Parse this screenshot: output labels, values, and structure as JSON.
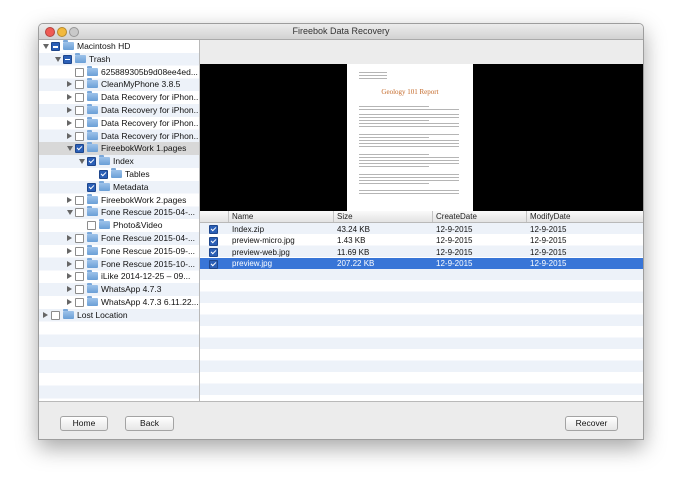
{
  "window": {
    "title": "Fireebok Data Recovery"
  },
  "tree": [
    {
      "label": "Macintosh HD",
      "level": 0,
      "tri": "open",
      "check": "mixed"
    },
    {
      "label": "Trash",
      "level": 1,
      "tri": "open",
      "check": "mixed"
    },
    {
      "label": "625889305b9d08ee4ed...",
      "level": 2,
      "tri": "none",
      "check": "off"
    },
    {
      "label": "CleanMyPhone 3.8.5",
      "level": 2,
      "tri": "closed",
      "check": "off"
    },
    {
      "label": "Data Recovery for iPhon...",
      "level": 2,
      "tri": "closed",
      "check": "off"
    },
    {
      "label": "Data Recovery for iPhon...",
      "level": 2,
      "tri": "closed",
      "check": "off"
    },
    {
      "label": "Data Recovery for iPhon...",
      "level": 2,
      "tri": "closed",
      "check": "off"
    },
    {
      "label": "Data Recovery for iPhon...",
      "level": 2,
      "tri": "closed",
      "check": "off"
    },
    {
      "label": "FireebokWork 1.pages",
      "level": 2,
      "tri": "open",
      "check": "on",
      "selected": true
    },
    {
      "label": "Index",
      "level": 3,
      "tri": "open",
      "check": "on"
    },
    {
      "label": "Tables",
      "level": 4,
      "tri": "none",
      "check": "on"
    },
    {
      "label": "Metadata",
      "level": 3,
      "tri": "none",
      "check": "on"
    },
    {
      "label": "FireebokWork 2.pages",
      "level": 2,
      "tri": "closed",
      "check": "off"
    },
    {
      "label": "Fone Rescue 2015-04-...",
      "level": 2,
      "tri": "open",
      "check": "off"
    },
    {
      "label": "Photo&Video",
      "level": 3,
      "tri": "none",
      "check": "off"
    },
    {
      "label": "Fone Rescue 2015-04-...",
      "level": 2,
      "tri": "closed",
      "check": "off"
    },
    {
      "label": "Fone Rescue 2015-09-...",
      "level": 2,
      "tri": "closed",
      "check": "off"
    },
    {
      "label": "Fone Rescue 2015-10-...",
      "level": 2,
      "tri": "closed",
      "check": "off"
    },
    {
      "label": "iLike 2014-12-25 – 09...",
      "level": 2,
      "tri": "closed",
      "check": "off"
    },
    {
      "label": "WhatsApp 4.7.3",
      "level": 2,
      "tri": "closed",
      "check": "off"
    },
    {
      "label": "WhatsApp 4.7.3 6.11.22...",
      "level": 2,
      "tri": "closed",
      "check": "off"
    },
    {
      "label": "Lost Location",
      "level": 0,
      "tri": "closed",
      "check": "off"
    }
  ],
  "preview": {
    "doc_title": "Geology 101 Report"
  },
  "files": {
    "columns": [
      "Name",
      "Size",
      "CreateDate",
      "ModifyDate"
    ],
    "rows": [
      {
        "name": "Index.zip",
        "size": "43.24 KB",
        "created": "12-9-2015",
        "modified": "12-9-2015",
        "selected": false
      },
      {
        "name": "preview-micro.jpg",
        "size": "1.43 KB",
        "created": "12-9-2015",
        "modified": "12-9-2015",
        "selected": false
      },
      {
        "name": "preview-web.jpg",
        "size": "11.69 KB",
        "created": "12-9-2015",
        "modified": "12-9-2015",
        "selected": false
      },
      {
        "name": "preview.jpg",
        "size": "207.22 KB",
        "created": "12-9-2015",
        "modified": "12-9-2015",
        "selected": true
      }
    ]
  },
  "buttons": {
    "home": "Home",
    "back": "Back",
    "recover": "Recover"
  },
  "colors": {
    "selection": "#3875d7",
    "accent": "#2b5fb6",
    "doc_title": "#c46a2a"
  }
}
